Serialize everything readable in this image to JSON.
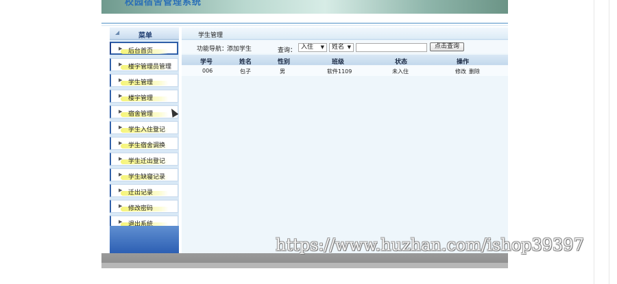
{
  "app": {
    "title": "校园宿舍管理系统"
  },
  "sidebar": {
    "header": "菜单",
    "items": [
      {
        "label": "后台首页"
      },
      {
        "label": "楼宇管理员管理"
      },
      {
        "label": "学生管理"
      },
      {
        "label": "楼宇管理"
      },
      {
        "label": "宿舍管理"
      },
      {
        "label": "学生入住登记"
      },
      {
        "label": "学生宿舍调换"
      },
      {
        "label": "学生迁出登记"
      },
      {
        "label": "学生缺寝记录"
      },
      {
        "label": "迁出记录"
      },
      {
        "label": "修改密码"
      },
      {
        "label": "退出系统"
      }
    ]
  },
  "content": {
    "breadcrumb": "学生管理",
    "nav_label": "功能导航：",
    "nav_link": "添加学生",
    "query_label": "查询：",
    "status_select": "入住",
    "field_select": "姓名",
    "search_value": "",
    "search_button": "点击查询",
    "table": {
      "headers": [
        "学号",
        "姓名",
        "性别",
        "班级",
        "状态",
        "操作"
      ],
      "rows": [
        {
          "id": "006",
          "name": "包子",
          "gender": "男",
          "class": "软件1109",
          "status": "未入住",
          "edit": "修改",
          "delete": "删除"
        }
      ]
    }
  },
  "watermark": "https://www.huzhan.com/ishop39397",
  "colors": {
    "accent": "#2f5fa8",
    "sidebar_bg": "#d8e8f6",
    "header_bg": "#c3d8ec"
  }
}
